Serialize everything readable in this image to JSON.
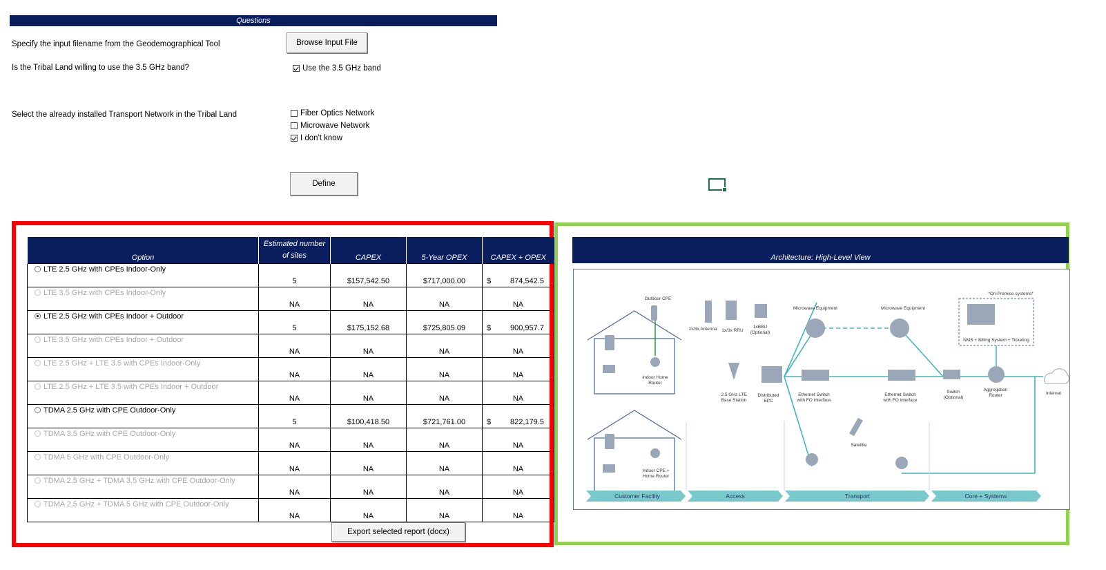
{
  "questions": {
    "header": "Questions",
    "q1": "Specify the input filename from the Geodemographical Tool",
    "q2": "Is the Tribal Land willing to use the 3.5 GHz band?",
    "q3": "Select the already installed Transport Network in the Tribal Land",
    "browse_button": "Browse Input File",
    "use35_label": "Use the 3.5 GHz band",
    "use35_checked": true,
    "transport_options": [
      {
        "label": "Fiber Optics Network",
        "checked": false
      },
      {
        "label": "Microwave Network",
        "checked": false
      },
      {
        "label": "I don't know",
        "checked": true
      }
    ],
    "define_button": "Define"
  },
  "table": {
    "headers": {
      "option": "Option",
      "sites_line1": "Estimated number",
      "sites_line2": "of sites",
      "capex": "CAPEX",
      "opex": "5-Year OPEX",
      "total": "CAPEX + OPEX"
    },
    "rows": [
      {
        "label": "LTE 2.5 GHz with CPEs Indoor-Only",
        "enabled": true,
        "selected": false,
        "sites": "5",
        "capex": "$157,542.50",
        "opex": "$717,000.00",
        "cur": "$",
        "total": "874,542.5"
      },
      {
        "label": "LTE 3.5 GHz with CPEs Indoor-Only",
        "enabled": false,
        "selected": false,
        "sites": "NA",
        "capex": "NA",
        "opex": "NA",
        "cur": "",
        "total": "NA"
      },
      {
        "label": "LTE 2.5 GHz with CPEs Indoor + Outdoor",
        "enabled": true,
        "selected": true,
        "sites": "5",
        "capex": "$175,152.68",
        "opex": "$725,805.09",
        "cur": "$",
        "total": "900,957.7"
      },
      {
        "label": "LTE 3.5 GHz with CPEs Indoor + Outdoor",
        "enabled": false,
        "selected": false,
        "sites": "NA",
        "capex": "NA",
        "opex": "NA",
        "cur": "",
        "total": "NA"
      },
      {
        "label": "LTE 2.5 GHz + LTE 3.5 with CPEs Indoor-Only",
        "enabled": false,
        "selected": false,
        "sites": "NA",
        "capex": "NA",
        "opex": "NA",
        "cur": "",
        "total": "NA"
      },
      {
        "label": "LTE 2.5 GHz + LTE 3.5 with CPEs Indoor + Outdoor",
        "enabled": false,
        "selected": false,
        "sites": "NA",
        "capex": "NA",
        "opex": "NA",
        "cur": "",
        "total": "NA"
      },
      {
        "label": "TDMA 2.5 GHz with CPE Outdoor-Only",
        "enabled": true,
        "selected": false,
        "sites": "5",
        "capex": "$100,418.50",
        "opex": "$721,761.00",
        "cur": "$",
        "total": "822,179.5"
      },
      {
        "label": "TDMA 3.5 GHz with CPE Outdoor-Only",
        "enabled": false,
        "selected": false,
        "sites": "NA",
        "capex": "NA",
        "opex": "NA",
        "cur": "",
        "total": "NA"
      },
      {
        "label": "TDMA 5 GHz with CPE Outdoor-Only",
        "enabled": false,
        "selected": false,
        "sites": "NA",
        "capex": "NA",
        "opex": "NA",
        "cur": "",
        "total": "NA"
      },
      {
        "label": "TDMA 2.5 GHz + TDMA 3.5 GHz with CPE Outdoor-Only",
        "enabled": false,
        "selected": false,
        "sites": "NA",
        "capex": "NA",
        "opex": "NA",
        "cur": "",
        "total": "NA"
      },
      {
        "label": "TDMA 2.5 GHz + TDMA 5 GHz with CPE Outdoor-Only",
        "enabled": false,
        "selected": false,
        "sites": "NA",
        "capex": "NA",
        "opex": "NA",
        "cur": "",
        "total": "NA"
      }
    ],
    "export_button": "Export selected report (docx)"
  },
  "architecture": {
    "header": "Architecture: High-Level View",
    "labels": {
      "outdoor_cpe": "Outdoor CPE",
      "indoor_home_router_1": "Indoor Home",
      "indoor_home_router_2": "Router",
      "antenna": "1x/3x Antenna",
      "rru": "1x/3x RRU",
      "bbu_1": "1xBBU",
      "bbu_2": "(Optional)",
      "base_station_1": "2.5 GHz LTE",
      "base_station_2": "Base Station",
      "epc_1": "Distributed",
      "epc_2": "EPC",
      "microwave_1": "Microwave Equipment",
      "microwave_2": "Microwave Equipment",
      "eth_switch_1a": "Ethernet Switch",
      "eth_switch_1b": "with FO interface",
      "eth_switch_2a": "Ethernet Switch",
      "eth_switch_2b": "with FO interface",
      "switch_1": "Switch",
      "switch_2": "(Optional)",
      "agg_router_1": "Aggregation",
      "agg_router_2": "Router",
      "internet": "Internet",
      "on_premise": "*On-Premise systems*",
      "nms": "NMS + Billing System + Ticketing",
      "satellite": "Satellite",
      "indoor_cpe_1": "Indoor CPE +",
      "indoor_cpe_2": "Home Router"
    },
    "bands": [
      "Customer Facility",
      "Access",
      "Transport",
      "Core + Systems"
    ],
    "colors": {
      "teal": "#3fb6be",
      "band": "#79c8cc",
      "house": "#4a6fa5"
    }
  }
}
